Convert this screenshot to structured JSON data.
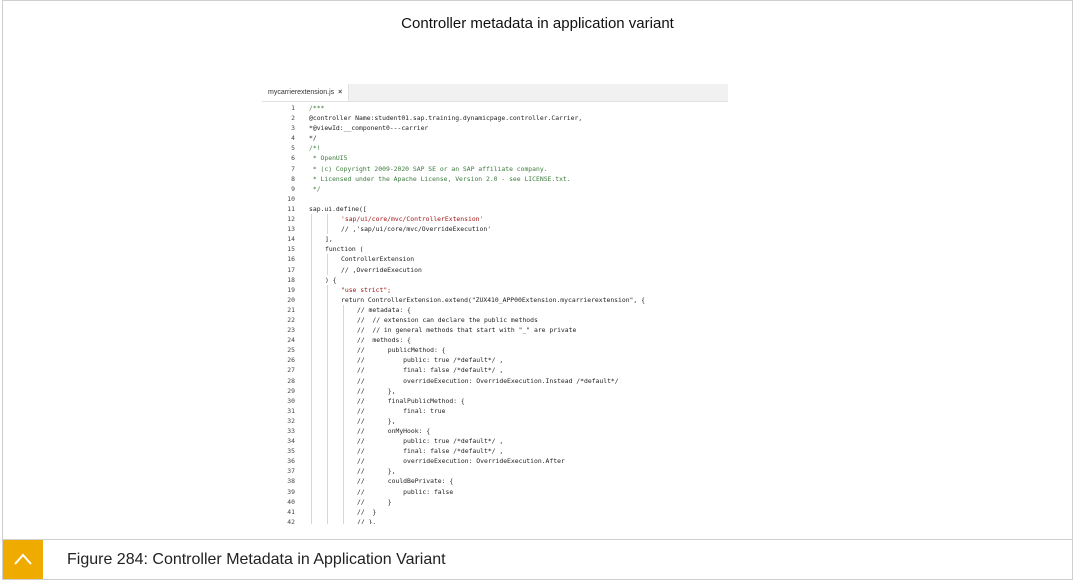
{
  "title": "Controller metadata in application variant",
  "editor": {
    "tab_label": "mycarrierextension.js",
    "tab_close": "×",
    "lines": [
      {
        "n": "1",
        "indent": 0,
        "text": "/***",
        "cls": "cm"
      },
      {
        "n": "2",
        "indent": 0,
        "text": "@controller Name:student01.sap.training.dynamicpage.controller.Carrier,",
        "cls": ""
      },
      {
        "n": "3",
        "indent": 0,
        "text": "*@viewId:__component0---carrier",
        "cls": ""
      },
      {
        "n": "4",
        "indent": 0,
        "text": "*/",
        "cls": ""
      },
      {
        "n": "5",
        "indent": 0,
        "text": "/*!",
        "cls": "cm"
      },
      {
        "n": "6",
        "indent": 0,
        "text": " * OpenUI5",
        "cls": "cm"
      },
      {
        "n": "7",
        "indent": 0,
        "text": " * (c) Copyright 2009-2020 SAP SE or an SAP affiliate company.",
        "cls": "cm"
      },
      {
        "n": "8",
        "indent": 0,
        "text": " * Licensed under the Apache License, Version 2.0 - see LICENSE.txt.",
        "cls": "cm"
      },
      {
        "n": "9",
        "indent": 0,
        "text": " */",
        "cls": "cm"
      },
      {
        "n": "10",
        "indent": 0,
        "text": "",
        "cls": ""
      },
      {
        "n": "11",
        "indent": 0,
        "text": "sap.ui.define([",
        "cls": ""
      },
      {
        "n": "12",
        "indent": 2,
        "text": "'sap/ui/core/mvc/ControllerExtension'",
        "cls": "str"
      },
      {
        "n": "13",
        "indent": 2,
        "text": "// ,'sap/ui/core/mvc/OverrideExecution'",
        "cls": ""
      },
      {
        "n": "14",
        "indent": 1,
        "text": "],",
        "cls": ""
      },
      {
        "n": "15",
        "indent": 1,
        "text": "function (",
        "cls": ""
      },
      {
        "n": "16",
        "indent": 2,
        "text": "ControllerExtension",
        "cls": ""
      },
      {
        "n": "17",
        "indent": 2,
        "text": "// ,OverrideExecution",
        "cls": ""
      },
      {
        "n": "18",
        "indent": 1,
        "text": ") {",
        "cls": ""
      },
      {
        "n": "19",
        "indent": 2,
        "text": "\"use strict\";",
        "cls": "str"
      },
      {
        "n": "20",
        "indent": 2,
        "text": "return ControllerExtension.extend(\"ZUX410_APP00Extension.mycarrierextension\", {",
        "cls": ""
      },
      {
        "n": "21",
        "indent": 3,
        "text": "// metadata: {",
        "cls": ""
      },
      {
        "n": "22",
        "indent": 3,
        "text": "//  // extension can declare the public methods",
        "cls": ""
      },
      {
        "n": "23",
        "indent": 3,
        "text": "//  // in general methods that start with \"_\" are private",
        "cls": ""
      },
      {
        "n": "24",
        "indent": 3,
        "text": "//  methods: {",
        "cls": ""
      },
      {
        "n": "25",
        "indent": 3,
        "text": "//      publicMethod: {",
        "cls": ""
      },
      {
        "n": "26",
        "indent": 3,
        "text": "//          public: true /*default*/ ,",
        "cls": ""
      },
      {
        "n": "27",
        "indent": 3,
        "text": "//          final: false /*default*/ ,",
        "cls": ""
      },
      {
        "n": "28",
        "indent": 3,
        "text": "//          overrideExecution: OverrideExecution.Instead /*default*/",
        "cls": ""
      },
      {
        "n": "29",
        "indent": 3,
        "text": "//      },",
        "cls": ""
      },
      {
        "n": "30",
        "indent": 3,
        "text": "//      finalPublicMethod: {",
        "cls": ""
      },
      {
        "n": "31",
        "indent": 3,
        "text": "//          final: true",
        "cls": ""
      },
      {
        "n": "32",
        "indent": 3,
        "text": "//      },",
        "cls": ""
      },
      {
        "n": "33",
        "indent": 3,
        "text": "//      onMyHook: {",
        "cls": ""
      },
      {
        "n": "34",
        "indent": 3,
        "text": "//          public: true /*default*/ ,",
        "cls": ""
      },
      {
        "n": "35",
        "indent": 3,
        "text": "//          final: false /*default*/ ,",
        "cls": ""
      },
      {
        "n": "36",
        "indent": 3,
        "text": "//          overrideExecution: OverrideExecution.After",
        "cls": ""
      },
      {
        "n": "37",
        "indent": 3,
        "text": "//      },",
        "cls": ""
      },
      {
        "n": "38",
        "indent": 3,
        "text": "//      couldBePrivate: {",
        "cls": ""
      },
      {
        "n": "39",
        "indent": 3,
        "text": "//          public: false",
        "cls": ""
      },
      {
        "n": "40",
        "indent": 3,
        "text": "//      }",
        "cls": ""
      },
      {
        "n": "41",
        "indent": 3,
        "text": "//  }",
        "cls": ""
      },
      {
        "n": "42",
        "indent": 3,
        "text": "// },",
        "cls": ""
      }
    ]
  },
  "caption": {
    "text": "Figure 284: Controller Metadata in Application Variant",
    "icon": "chevron-up-icon",
    "accent": "#f0ab00"
  }
}
